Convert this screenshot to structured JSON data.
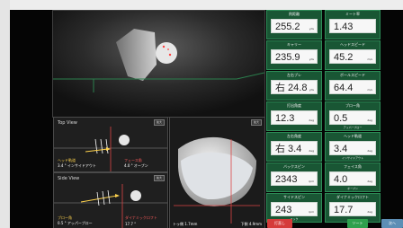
{
  "top_view": {
    "title": "Top View",
    "badge": "拡大",
    "left_label": "ヘッド軌道",
    "left_value": "3.4 ° インサイドアウト",
    "right_label": "フェース角",
    "right_value": "4.0 ° オープン"
  },
  "side_view": {
    "title": "Side View",
    "badge": "拡大",
    "left_label": "ブロー角",
    "left_value": "0.5 ° アッパーブロー",
    "right_label": "ダイナミックロフト",
    "right_value": "17.7 °"
  },
  "face_view": {
    "badge": "拡大",
    "bottom_left": "トゥ側 1.7mm",
    "bottom_right": "下側 4.9mm"
  },
  "metrics": [
    {
      "label": "飛距離",
      "value": "255.2",
      "unit": "yds",
      "sub": ""
    },
    {
      "label": "ミート率",
      "value": "1.43",
      "unit": "",
      "sub": ""
    },
    {
      "label": "キャリー",
      "value": "235.9",
      "unit": "yds",
      "sub": ""
    },
    {
      "label": "ヘッドスピード",
      "value": "45.2",
      "unit": "m/s",
      "sub": ""
    },
    {
      "label": "左右ブレ",
      "value": "右 24.8",
      "unit": "yds",
      "sub": ""
    },
    {
      "label": "ボールスピード",
      "value": "64.4",
      "unit": "m/s",
      "sub": ""
    },
    {
      "label": "打出角度",
      "value": "12.3",
      "unit": "deg",
      "sub": ""
    },
    {
      "label": "ブロー角",
      "value": "0.5",
      "unit": "deg",
      "sub": "アッパーブロー"
    },
    {
      "label": "左右角度",
      "value": "右 3.4",
      "unit": "deg",
      "sub": ""
    },
    {
      "label": "ヘッド軌道",
      "value": "3.4",
      "unit": "deg",
      "sub": "インサイドアウト"
    },
    {
      "label": "バックスピン",
      "value": "2343",
      "unit": "rpm",
      "sub": ""
    },
    {
      "label": "フェイス角",
      "value": "4.0",
      "unit": "deg",
      "sub": "オープン"
    },
    {
      "label": "サイドスピン",
      "value": "243",
      "unit": "rpm",
      "sub": "フック"
    },
    {
      "label": "ダイナミックロフト",
      "value": "17.7",
      "unit": "deg",
      "sub": ""
    }
  ],
  "buttons": {
    "left": "打直し",
    "middle": "ソート",
    "right": "次へ"
  },
  "colors": {
    "accent": "#2fa04d",
    "panel": "#1b5634",
    "danger": "#d53b3a",
    "blue": "#5c8eb5"
  }
}
